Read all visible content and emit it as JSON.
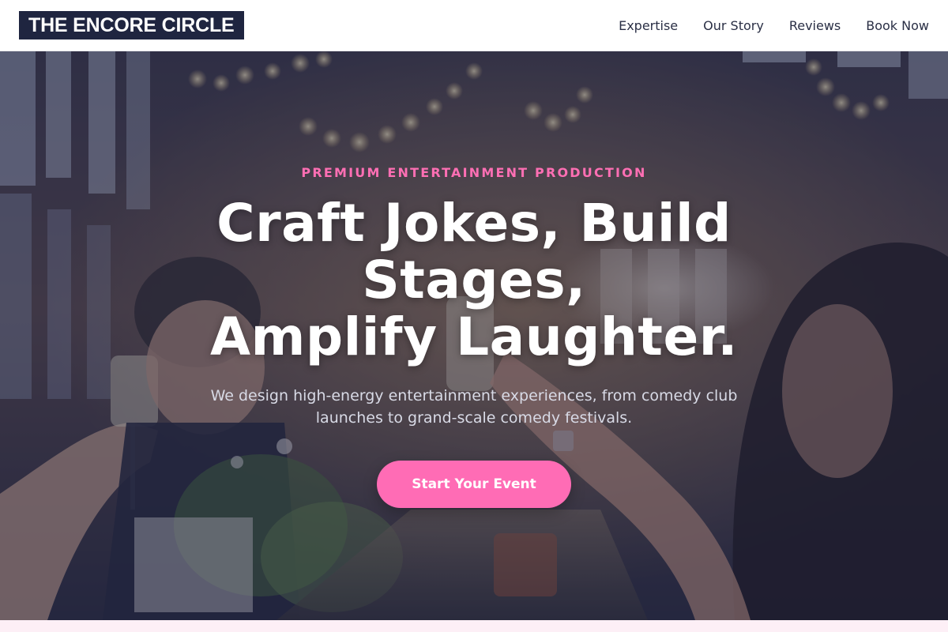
{
  "nav": {
    "logo": "THE ENCORE CIRCLE",
    "links": [
      {
        "label": "Expertise"
      },
      {
        "label": "Our Story"
      },
      {
        "label": "Reviews"
      },
      {
        "label": "Book Now"
      }
    ]
  },
  "hero": {
    "eyebrow": "PREMIUM ENTERTAINMENT PRODUCTION",
    "headline_lines": [
      "Craft Jokes, Build",
      "Stages,",
      "Amplify Laughter."
    ],
    "subtitle": "We design high-energy entertainment experiences, from comedy club launches to grand-scale comedy festivals.",
    "cta_label": "Start Your Event",
    "background_image": "people-toasting-with-champagne-at-banquet"
  },
  "colors": {
    "brand_navy": "#1f2540",
    "accent_pink": "#ff6cb5",
    "eyebrow_pink": "#ff6fb4",
    "hero_overlay": "#1e2240"
  }
}
